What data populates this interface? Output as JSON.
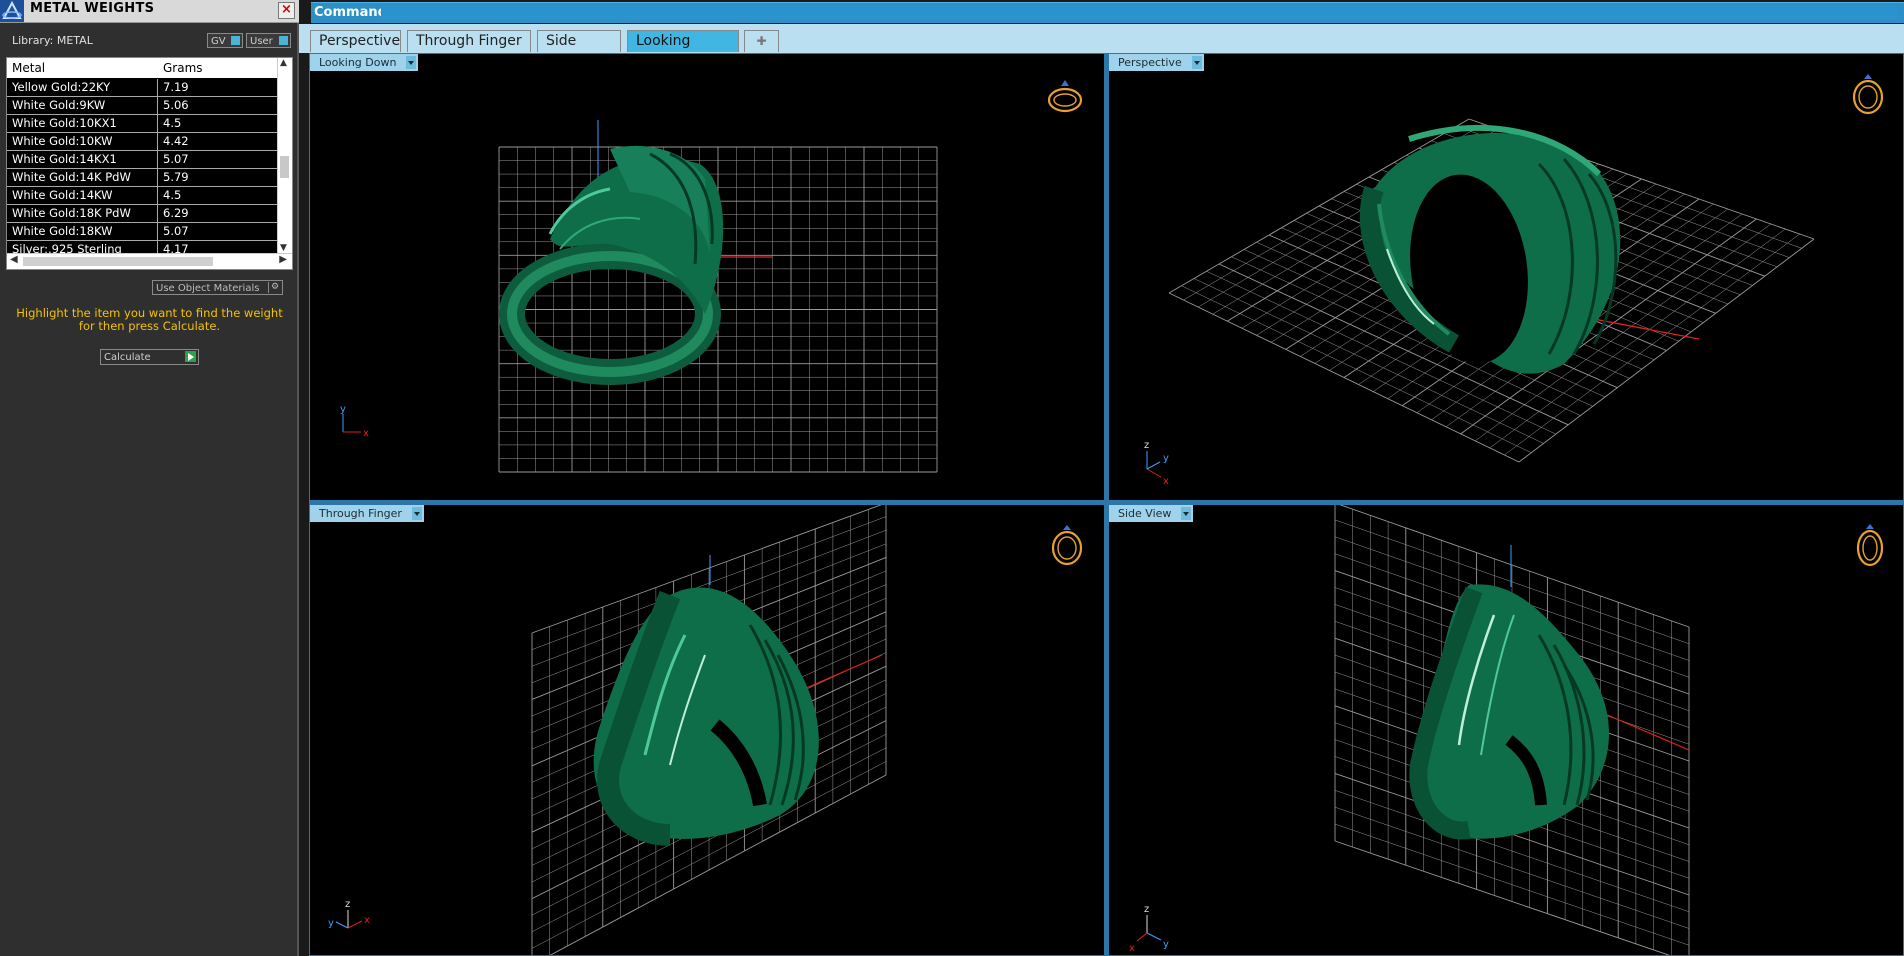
{
  "panel": {
    "title": "METAL WEIGHTS",
    "library_label": "Library: METAL",
    "gv_label": "GV",
    "user_label": "User",
    "columns": [
      "Metal",
      "Grams"
    ],
    "rows": [
      {
        "metal": "Yellow Gold:22KY",
        "grams": "7.19"
      },
      {
        "metal": "White Gold:9KW",
        "grams": "5.06"
      },
      {
        "metal": "White Gold:10KX1",
        "grams": "4.5"
      },
      {
        "metal": "White Gold:10KW",
        "grams": "4.42"
      },
      {
        "metal": "White Gold:14KX1",
        "grams": "5.07"
      },
      {
        "metal": "White Gold:14K PdW",
        "grams": "5.79"
      },
      {
        "metal": "White Gold:14KW",
        "grams": "4.5"
      },
      {
        "metal": "White Gold:18K PdW",
        "grams": "6.29"
      },
      {
        "metal": "White Gold:18KW",
        "grams": "5.07"
      },
      {
        "metal": "Silver:.925 Sterling",
        "grams": "4.17"
      }
    ],
    "use_object_materials": "Use Object Materials",
    "hint": "Highlight the item you want to find the weight for then press Calculate.",
    "calculate": "Calculate"
  },
  "command": {
    "label": "Command:"
  },
  "tabs": [
    "Perspective",
    "Through Finger",
    "Side View",
    "Looking Down"
  ],
  "active_tab": "Looking Down",
  "viewports": {
    "top_left": "Looking Down",
    "top_right": "Perspective",
    "bottom_left": "Through Finger",
    "bottom_right": "Side View"
  },
  "axes": {
    "x": "x",
    "y": "y",
    "z": "z"
  },
  "colors": {
    "ring": "#0f6e4a",
    "ring_highlight": "#2fa877",
    "grid": "#b8b8b8",
    "accent": "#2b8fc8",
    "hint_text": "#f3c200",
    "axis_x": "#e02020",
    "axis_y": "#3aa0ff"
  },
  "icons": {
    "app": "app-logo-icon",
    "close": "close-icon",
    "ring": "ring-icon",
    "add_tab": "plus-icon"
  }
}
